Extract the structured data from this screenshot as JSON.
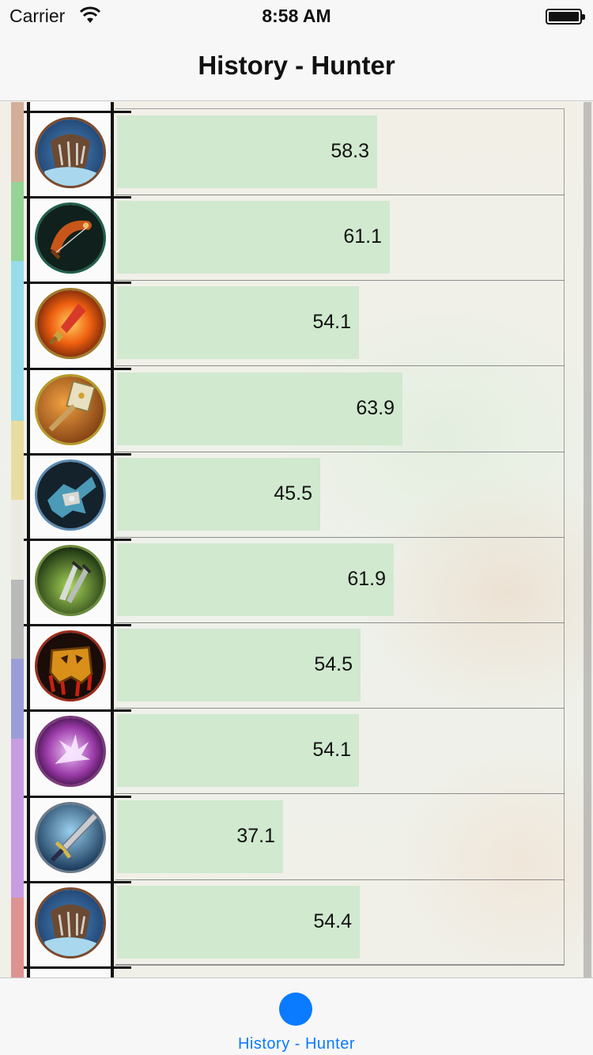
{
  "status_bar": {
    "carrier": "Carrier",
    "time": "8:58 AM"
  },
  "nav": {
    "title": "History - Hunter"
  },
  "rows": [
    {
      "value": "58.3",
      "fraction": 0.583,
      "icon": "bear-claw-icon",
      "ring": "#7b4a2c"
    },
    {
      "value": "61.1",
      "fraction": 0.611,
      "icon": "bow-icon",
      "ring": "#1f5e4a"
    },
    {
      "value": "54.1",
      "fraction": 0.541,
      "icon": "fire-sword-icon",
      "ring": "#a07a2a"
    },
    {
      "value": "63.9",
      "fraction": 0.639,
      "icon": "hammer-icon",
      "ring": "#b59a2a"
    },
    {
      "value": "45.5",
      "fraction": 0.455,
      "icon": "gauntlet-icon",
      "ring": "#5b8ab2"
    },
    {
      "value": "61.9",
      "fraction": 0.619,
      "icon": "twin-daggers-icon",
      "ring": "#6a8a3a"
    },
    {
      "value": "54.5",
      "fraction": 0.545,
      "icon": "skull-emblem-icon",
      "ring": "#9a2a1a"
    },
    {
      "value": "54.1",
      "fraction": 0.541,
      "icon": "arcane-hand-icon",
      "ring": "#7a3a7a"
    },
    {
      "value": "37.1",
      "fraction": 0.371,
      "icon": "sword-icon",
      "ring": "#6a7a8a"
    },
    {
      "value": "54.4",
      "fraction": 0.544,
      "icon": "bear-claw-icon",
      "ring": "#7b4a2c"
    }
  ],
  "color_strip": [
    "#d3ae98",
    "#95d495",
    "#97dcea",
    "#97dcea",
    "#e9dca0",
    "#ecebe3",
    "#b9b9b9",
    "#9a9ed8",
    "#c89ce0",
    "#c89ce0",
    "#de9292"
  ],
  "tab_bar": {
    "label": "History - Hunter",
    "accent": "#0a7aff"
  },
  "colors": {
    "bar": "#d0e9cf",
    "accent": "#0a7aff"
  }
}
